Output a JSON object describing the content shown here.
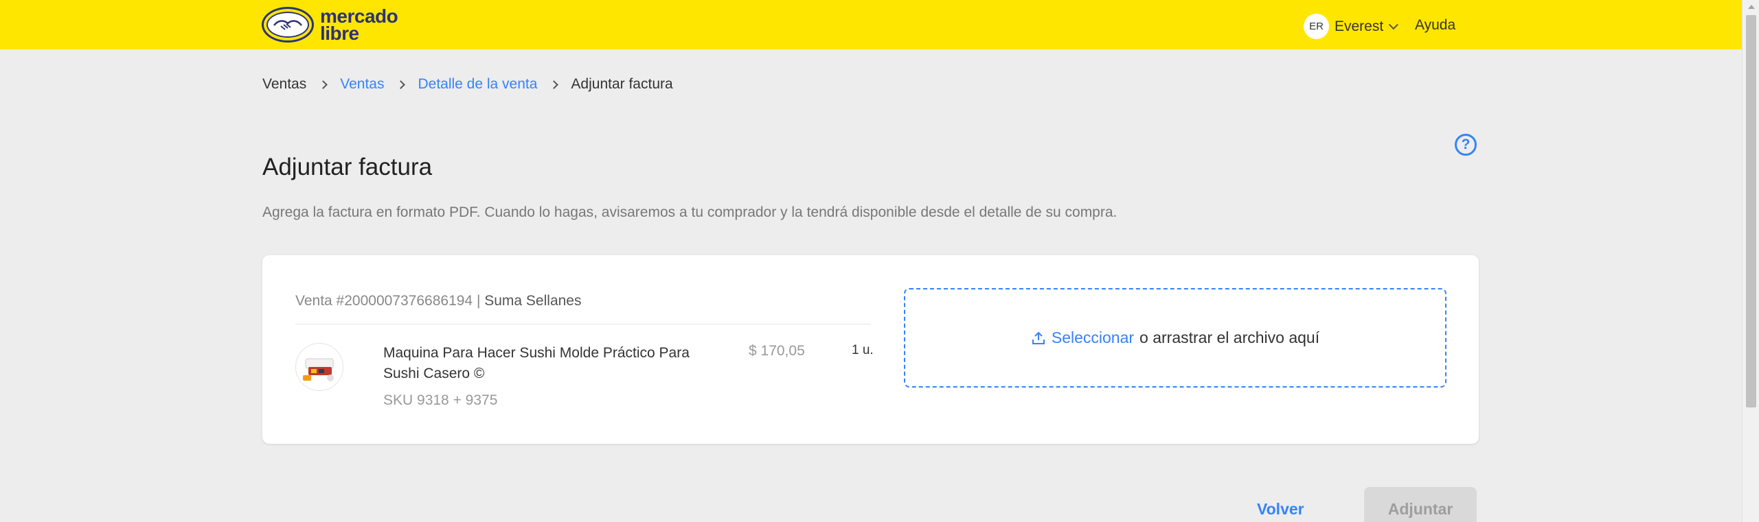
{
  "header": {
    "logo_line1": "mercado",
    "logo_line2": "libre",
    "user_initials": "ER",
    "user_name": "Everest",
    "help_label": "Ayuda"
  },
  "breadcrumb": {
    "items": [
      {
        "label": "Ventas",
        "link": false
      },
      {
        "label": "Ventas",
        "link": true
      },
      {
        "label": "Detalle de la venta",
        "link": true
      },
      {
        "label": "Adjuntar factura",
        "link": false
      }
    ]
  },
  "page": {
    "help_icon": "?",
    "title": "Adjuntar factura",
    "description": "Agrega la factura en formato PDF. Cuando lo hagas, avisaremos a tu comprador y la tendrá disponible desde el detalle de su compra."
  },
  "sale": {
    "id_label": "Venta #2000007376686194",
    "separator": " | ",
    "buyer": "Suma Sellanes"
  },
  "product": {
    "title": "Maquina Para Hacer Sushi Molde Práctico Para Sushi Casero ©",
    "sku": "SKU 9318 + 9375",
    "price": "$ 170,05",
    "quantity": "1 u."
  },
  "dropzone": {
    "link_text": "Seleccionar",
    "rest_text": "o arrastrar el archivo aquí"
  },
  "actions": {
    "back_label": "Volver",
    "attach_label": "Adjuntar"
  },
  "colors": {
    "header_yellow": "#ffe600",
    "accent_blue": "#3483fa",
    "background": "#ededed"
  }
}
